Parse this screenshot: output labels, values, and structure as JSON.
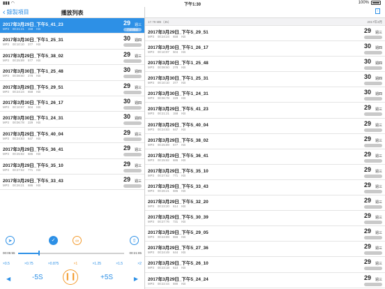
{
  "status": {
    "time": "下午1:30",
    "battery": "100%"
  },
  "left": {
    "back_label": "錄製項目",
    "title": "播放列表",
    "rows": [
      {
        "name": "2017年3月29日_下午5_41_23",
        "meta": "MP3 00:21:21 158 KB",
        "day": "29",
        "weekday": "週三",
        "tag": "目前播放",
        "active": true
      },
      {
        "name": "2017年3月30日_下午1_25_31",
        "meta": "MP3 00:10:10 377 KB",
        "day": "30",
        "weekday": "週四",
        "tag": "",
        "active": false
      },
      {
        "name": "2017年3月29日_下午5_38_02",
        "meta": "MP3 00:25:89 577 KB",
        "day": "29",
        "weekday": "週三",
        "tag": "",
        "active": false
      },
      {
        "name": "2017年3月30日_下午1_25_48",
        "meta": "MP3 00:08:60 278 KB",
        "day": "30",
        "weekday": "週四",
        "tag": "",
        "active": false
      },
      {
        "name": "2017年3月29日_下午5_29_51",
        "meta": "MP3 00:24:24 658 KB",
        "day": "29",
        "weekday": "週三",
        "tag": "",
        "active": false
      },
      {
        "name": "2017年3月30日_下午1_26_17",
        "meta": "MP3 00:10:97 504 KB",
        "day": "30",
        "weekday": "週四",
        "tag": "",
        "active": false
      },
      {
        "name": "2017年3月30日_下午1_24_31",
        "meta": "MP3 00:06:78 229 KB",
        "day": "30",
        "weekday": "週四",
        "tag": "",
        "active": false
      },
      {
        "name": "2017年3月29日_下午5_40_04",
        "meta": "MP3 00:24:83 647 KB",
        "day": "29",
        "weekday": "週三",
        "tag": "",
        "active": false
      },
      {
        "name": "2017年3月29日_下午5_36_41",
        "meta": "MP3 00:25:82 686 KB",
        "day": "29",
        "weekday": "週三",
        "tag": "",
        "active": false
      },
      {
        "name": "2017年3月29日_下午5_35_10",
        "meta": "MP3 00:27:62 771 KB",
        "day": "29",
        "weekday": "週三",
        "tag": "",
        "active": false
      },
      {
        "name": "2017年3月29日_下午5_33_43",
        "meta": "MP3 00:26:21 686 KB",
        "day": "29",
        "weekday": "週三",
        "tag": "",
        "active": false
      }
    ]
  },
  "player": {
    "elapsed": "00:05:55",
    "total": "00:21:85",
    "progress": 0.2,
    "speeds": [
      "×0.5",
      "×0.75",
      "×0.875",
      "×1",
      "×1.25",
      "×1.5",
      "×2"
    ],
    "selected_speed_index": 3,
    "skip_back": "-5S",
    "skip_fwd": "+5S",
    "icons": [
      "share-icon",
      "check-icon",
      "loop-icon",
      "export-icon"
    ]
  },
  "right": {
    "info": "17.79 MB（35）",
    "month": "2017年3月",
    "rows": [
      {
        "name": "2017年3月29日_下午5_29_51",
        "meta": "MP3 00:24:24 658 KB",
        "day": "29",
        "weekday": "週三"
      },
      {
        "name": "2017年3月30日_下午1_26_17",
        "meta": "MP3 00:10:97 504 KB",
        "day": "30",
        "weekday": "週四"
      },
      {
        "name": "2017年3月30日_下午1_25_48",
        "meta": "MP3 00:08:60 278 KB",
        "day": "30",
        "weekday": "週四"
      },
      {
        "name": "2017年3月30日_下午1_25_31",
        "meta": "MP3 00:10:10 377 KB",
        "day": "30",
        "weekday": "週四"
      },
      {
        "name": "2017年3月30日_下午1_24_31",
        "meta": "MP3 00:06:78 229 KB",
        "day": "30",
        "weekday": "週四"
      },
      {
        "name": "2017年3月29日_下午5_41_23",
        "meta": "MP3 00:21:21 158 KB",
        "day": "29",
        "weekday": "週三"
      },
      {
        "name": "2017年3月29日_下午5_40_04",
        "meta": "MP3 00:24:83 647 KB",
        "day": "29",
        "weekday": "週三"
      },
      {
        "name": "2017年3月29日_下午5_38_02",
        "meta": "MP3 00:25:89 577 KB",
        "day": "29",
        "weekday": "週三"
      },
      {
        "name": "2017年3月29日_下午5_36_41",
        "meta": "MP3 00:25:82 686 KB",
        "day": "29",
        "weekday": "週三"
      },
      {
        "name": "2017年3月29日_下午5_35_10",
        "meta": "MP3 00:27:62 771 KB",
        "day": "29",
        "weekday": "週三"
      },
      {
        "name": "2017年3月29日_下午5_33_43",
        "meta": "MP3 00:26:21 686 KB",
        "day": "29",
        "weekday": "週三"
      },
      {
        "name": "2017年3月29日_下午5_32_20",
        "meta": "MP3 00:23:20 614 KB",
        "day": "29",
        "weekday": "週三"
      },
      {
        "name": "2017年3月29日_下午5_30_39",
        "meta": "MP3 00:27:76 731 KB",
        "day": "29",
        "weekday": "週三"
      },
      {
        "name": "2017年3月29日_下午5_29_05",
        "meta": "MP3 00:24:89 656 KB",
        "day": "29",
        "weekday": "週三"
      },
      {
        "name": "2017年3月29日_下午5_27_36",
        "meta": "MP3 00:24:49 644 KB",
        "day": "29",
        "weekday": "週三"
      },
      {
        "name": "2017年3月29日_下午5_26_10",
        "meta": "MP3 00:23:18 610 KB",
        "day": "29",
        "weekday": "週三"
      },
      {
        "name": "2017年3月29日_下午5_24_24",
        "meta": "MP3 00:22:44 590 KB",
        "day": "29",
        "weekday": "週三"
      }
    ]
  }
}
